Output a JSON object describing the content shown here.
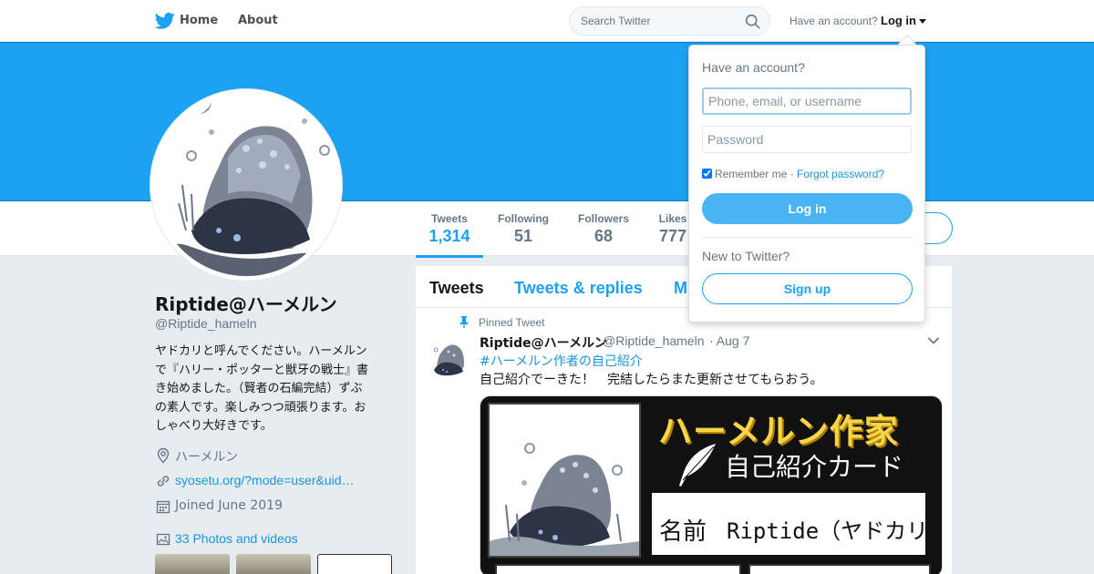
{
  "topbar": {
    "home_label": "Home",
    "about_label": "About",
    "search_placeholder": "Search Twitter",
    "have_account": "Have an account?",
    "login_label": "Log in"
  },
  "stats": [
    {
      "label": "Tweets",
      "value": "1,314"
    },
    {
      "label": "Following",
      "value": "51"
    },
    {
      "label": "Followers",
      "value": "68"
    },
    {
      "label": "Likes",
      "value": "777"
    }
  ],
  "profile": {
    "name": "Riptide@ハーメルン",
    "handle": "@Riptide_hameln",
    "bio_lines": [
      "ヤドカリと呼んでください。ハーメルン",
      "で『ハリー・ポッターと獣牙の戦士』書",
      "き始めました。（賢者の石編完結）ずぶ",
      "の素人です。楽しみつつ頑張ります。お",
      "しゃべり大好きです。"
    ],
    "location": "ハーメルン",
    "url": "syosetu.org/?mode=user&uid…",
    "joined": "Joined June 2019",
    "photos": "33 Photos and videos"
  },
  "timeline": {
    "tabs": [
      "Tweets",
      "Tweets & replies",
      "M"
    ],
    "pinned_label": "Pinned Tweet",
    "tweet": {
      "name": "Riptide@ハーメルン",
      "handle": "@Riptide_hameln",
      "date": "· Aug 7",
      "hashtag": "#ハーメルン作者の自己紹介",
      "text": "自己紹介でーきた！　完結したらまた更新させてもらおう。",
      "card": {
        "title": "ハーメルン作家",
        "subtitle": "自己紹介カード",
        "name_label": "名前",
        "name_value": "Riptide（ヤドカリ）"
      }
    }
  },
  "login_dropdown": {
    "title": "Have an account?",
    "username_placeholder": "Phone, email, or username",
    "password_placeholder": "Password",
    "remember_me": "Remember me",
    "forgot_password": "Forgot password?",
    "login_button": "Log in",
    "new_to_twitter": "New to Twitter?",
    "signup_button": "Sign up"
  },
  "colors": {
    "accent": "#1da1f2",
    "banner": "#1da1f2",
    "background": "#e6ecf0"
  }
}
